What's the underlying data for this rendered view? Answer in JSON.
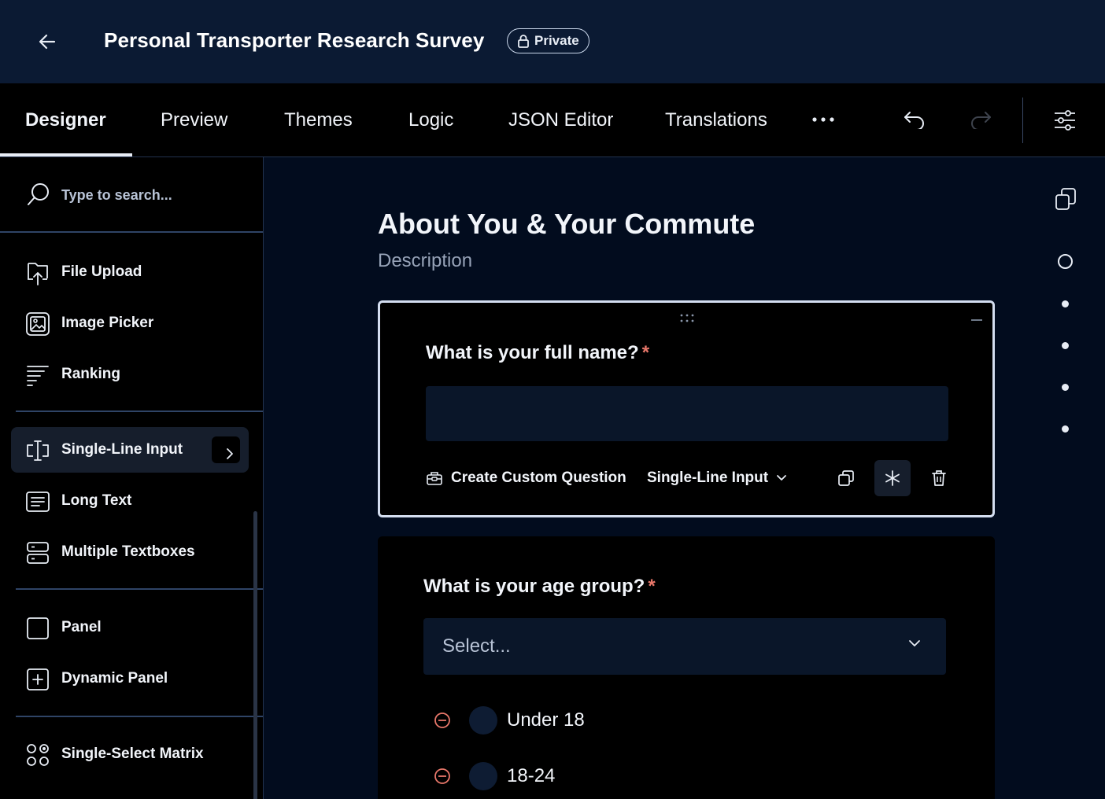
{
  "header": {
    "title": "Personal Transporter Research Survey",
    "badge": "Private"
  },
  "tabs": [
    "Designer",
    "Preview",
    "Themes",
    "Logic",
    "JSON Editor",
    "Translations"
  ],
  "active_tab": "Designer",
  "sidebar": {
    "search_placeholder": "Type to search...",
    "groups": [
      [
        {
          "label": "File Upload",
          "icon": "file-upload-icon"
        },
        {
          "label": "Image Picker",
          "icon": "image-picker-icon"
        },
        {
          "label": "Ranking",
          "icon": "ranking-icon"
        }
      ],
      [
        {
          "label": "Single-Line Input",
          "icon": "single-line-input-icon",
          "selected": true
        },
        {
          "label": "Long Text",
          "icon": "long-text-icon"
        },
        {
          "label": "Multiple Textboxes",
          "icon": "multiple-textboxes-icon"
        }
      ],
      [
        {
          "label": "Panel",
          "icon": "panel-icon"
        },
        {
          "label": "Dynamic Panel",
          "icon": "dynamic-panel-icon"
        }
      ],
      [
        {
          "label": "Single-Select Matrix",
          "icon": "single-select-matrix-icon"
        }
      ]
    ]
  },
  "page": {
    "title": "About You & Your Commute",
    "description": "Description"
  },
  "questions": [
    {
      "title": "What is your full name?",
      "required_mark": "*",
      "toolbar": {
        "create_custom": "Create Custom Question",
        "type": "Single-Line Input"
      }
    },
    {
      "title": "What is your age group?",
      "required_mark": "*",
      "select_placeholder": "Select...",
      "choices": [
        "Under 18",
        "18-24"
      ]
    }
  ],
  "colors": {
    "header_bg": "#0b1a33",
    "bar_bg": "#000000",
    "canvas_bg": "#020c1e",
    "required": "#e8776a",
    "remove_icon": "#e8776a"
  }
}
